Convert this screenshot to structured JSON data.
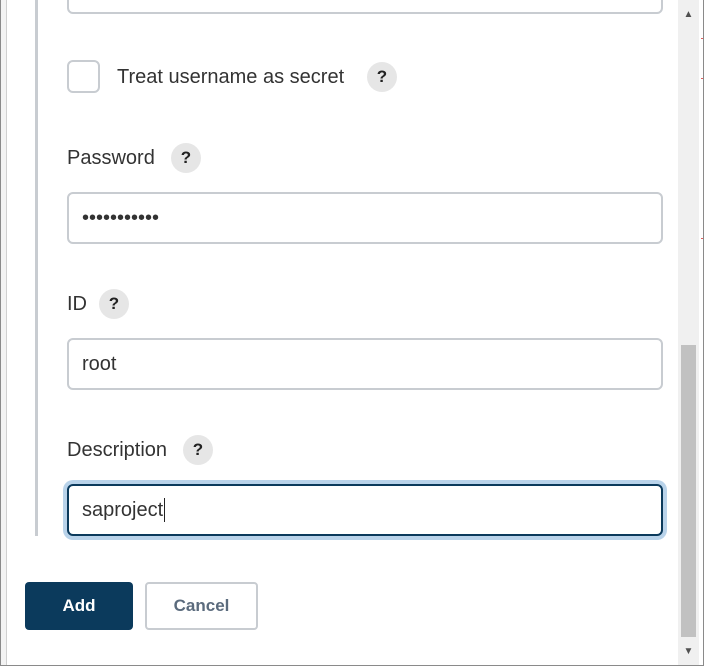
{
  "form": {
    "username_secret_label": "Treat username as secret",
    "password": {
      "label": "Password",
      "value": "•••••••••••"
    },
    "id": {
      "label": "ID",
      "value": "root"
    },
    "description": {
      "label": "Description",
      "value": "saproject"
    },
    "help_glyph": "?"
  },
  "actions": {
    "add_label": "Add",
    "cancel_label": "Cancel"
  },
  "scrollbar": {
    "up_glyph": "▲",
    "down_glyph": "▼"
  },
  "colors": {
    "primary": "#0b3a5c",
    "border": "#c8ccd1",
    "focus_ring": "#b9d3ea",
    "help_bg": "#e6e6e6"
  },
  "icons": {
    "help": "question-mark-icon",
    "scroll_up": "scroll-up-arrow-icon",
    "scroll_down": "scroll-down-arrow-icon"
  }
}
